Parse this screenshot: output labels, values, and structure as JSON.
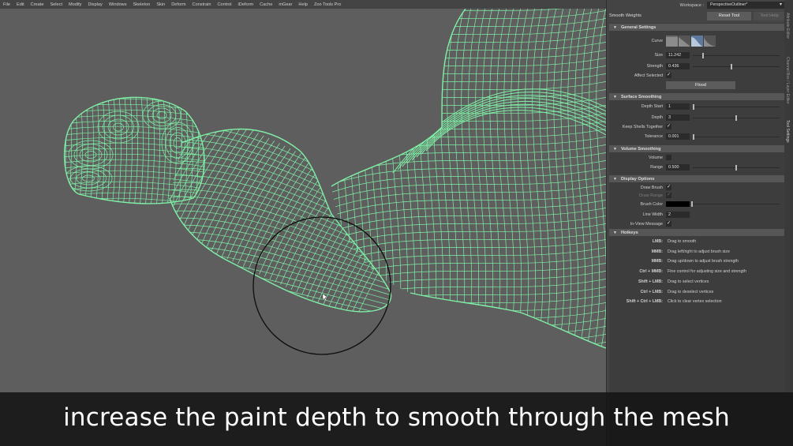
{
  "menubar": {
    "items": [
      "File",
      "Edit",
      "Create",
      "Select",
      "Modify",
      "Display",
      "Windows",
      "Skeleton",
      "Skin",
      "Deform",
      "Constrain",
      "Control",
      "iDeform",
      "Cache",
      "mGear",
      "Help",
      "Zoo Tools Pro"
    ]
  },
  "workspace": {
    "label": "Workspace :",
    "value": "PerspectiveOutliner*"
  },
  "tool": {
    "title": "Smooth Weights",
    "reset_label": "Reset Tool",
    "help_label": "Tool Help"
  },
  "sections": {
    "general": "General Settings",
    "surface": "Surface Smoothing",
    "volume": "Volume Smoothing",
    "display": "Display Options",
    "hotkeys": "Hotkeys"
  },
  "general": {
    "curve_label": "Curve",
    "size_label": "Size",
    "size_value": "11.242",
    "size_fraction": 0.11,
    "strength_label": "Strength",
    "strength_value": "0.436",
    "strength_fraction": 0.44,
    "affect_selected_label": "Affect Selected",
    "affect_selected": true,
    "flood_label": "Flood"
  },
  "surface": {
    "depth_start_label": "Depth Start",
    "depth_start_value": "1",
    "depth_start_fraction": 0.0,
    "depth_label": "Depth",
    "depth_value": "3",
    "depth_fraction": 0.5,
    "keep_shells_label": "Keep Shells Together",
    "keep_shells": true,
    "tolerance_label": "Tolerance",
    "tolerance_value": "0.001",
    "tolerance_fraction": 0.0
  },
  "volume": {
    "volume_label": "Volume",
    "volume_checked": false,
    "range_label": "Range",
    "range_value": "0.500",
    "range_fraction": 0.5
  },
  "display": {
    "draw_brush_label": "Draw Brush",
    "draw_brush": true,
    "draw_range_label": "Draw Range",
    "draw_range": true,
    "brush_color_label": "Brush Color",
    "brush_color": "#000000",
    "line_width_label": "Line Width",
    "line_width_value": "2",
    "inview_label": "In-View Message",
    "inview": true
  },
  "hotkeys": [
    {
      "key": "LMB:",
      "desc": "Drag to smooth"
    },
    {
      "key": "MMB:",
      "desc": "Drag left/right to adjust brush size"
    },
    {
      "key": "MMB:",
      "desc": "Drag up/down to adjust brush strength"
    },
    {
      "key": "Ctrl + MMB:",
      "desc": "Fine control for adjusting size and strength"
    },
    {
      "key": "Shift + LMB:",
      "desc": "Drag to select vertices"
    },
    {
      "key": "Ctrl + LMB:",
      "desc": "Drag to deselect vertices"
    },
    {
      "key": "Shift + Ctrl + LMB:",
      "desc": "Click to clear vertex selection"
    }
  ],
  "side_tabs": [
    "Attribute Editor",
    "Channel Box / Layer Editor",
    "Tool Settings"
  ],
  "subtitle": "increase the paint depth to smooth through the mesh",
  "colors": {
    "wireframe": "#7ff0a6",
    "viewport_bg": "#5e5e5e",
    "panel_bg": "#444444"
  }
}
